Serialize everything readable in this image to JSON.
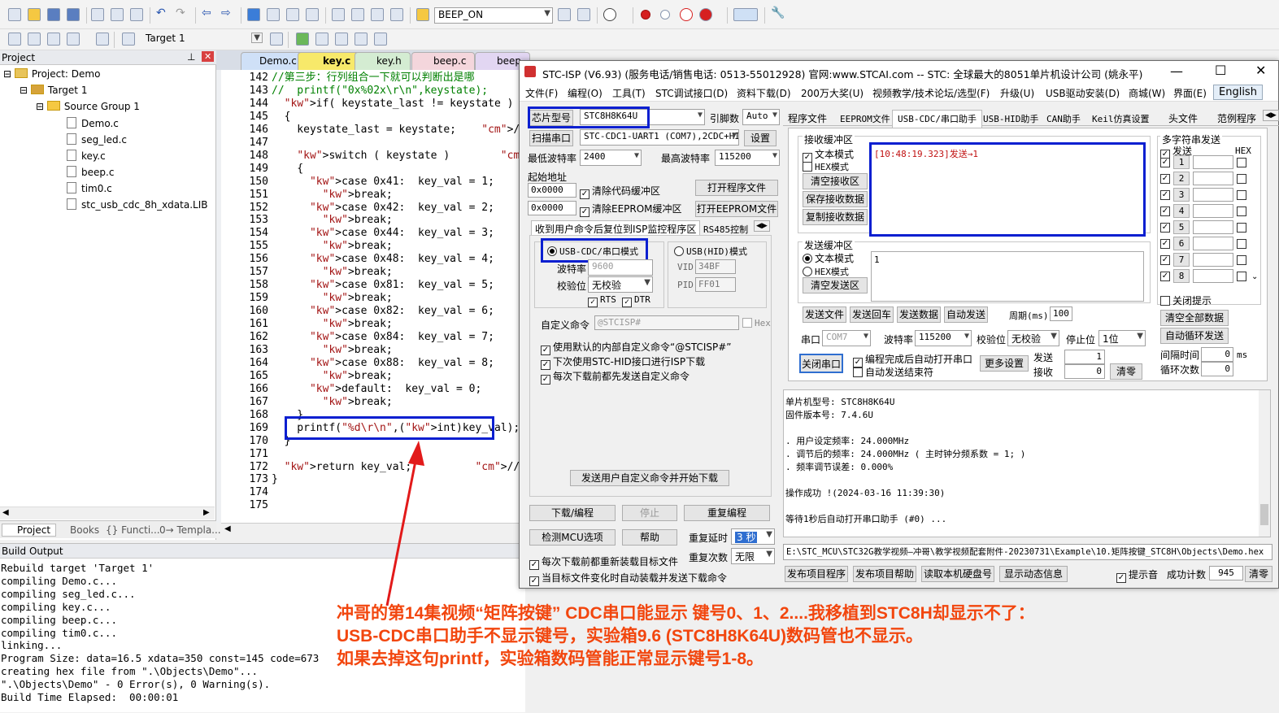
{
  "keil": {
    "toolbar1": {
      "target_combo": "BEEP_ON"
    },
    "toolbar2": {
      "target_combo": "Target 1"
    },
    "project_panel": {
      "title": "Project",
      "items": [
        "Project: Demo",
        "Target 1",
        "Source Group 1",
        "Demo.c",
        "seg_led.c",
        "key.c",
        "beep.c",
        "tim0.c",
        "stc_usb_cdc_8h_xdata.LIB"
      ],
      "bottom_tabs": [
        "Project",
        "Books",
        "{} Functi...",
        "0→ Templa..."
      ]
    },
    "editor_tabs": [
      "Demo.c",
      "key.c",
      "key.h",
      "beep.c",
      "beep"
    ],
    "code": [
      {
        "n": "142",
        "t": "//第三步：行列组合一下就可以判断出是哪",
        "c": "cm"
      },
      {
        "n": "143",
        "t": "//  printf(\"0x%02x\\r\\n\",keystate);",
        "c": "cm"
      },
      {
        "n": "144",
        "t": "  if( keystate_last != keystate )    //",
        "c": ""
      },
      {
        "n": "145",
        "t": "  {",
        "c": ""
      },
      {
        "n": "146",
        "t": "    keystate_last = keystate;    //把本",
        "c": ""
      },
      {
        "n": "147",
        "t": "",
        "c": ""
      },
      {
        "n": "148",
        "t": "    switch ( keystate )        //根据这",
        "c": ""
      },
      {
        "n": "149",
        "t": "    {",
        "c": ""
      },
      {
        "n": "150",
        "t": "      case 0x41:  key_val = 1;",
        "c": ""
      },
      {
        "n": "151",
        "t": "        break;",
        "c": ""
      },
      {
        "n": "152",
        "t": "      case 0x42:  key_val = 2;",
        "c": ""
      },
      {
        "n": "153",
        "t": "        break;",
        "c": ""
      },
      {
        "n": "154",
        "t": "      case 0x44:  key_val = 3;",
        "c": ""
      },
      {
        "n": "155",
        "t": "        break;",
        "c": ""
      },
      {
        "n": "156",
        "t": "      case 0x48:  key_val = 4;",
        "c": ""
      },
      {
        "n": "157",
        "t": "        break;",
        "c": ""
      },
      {
        "n": "158",
        "t": "      case 0x81:  key_val = 5;",
        "c": ""
      },
      {
        "n": "159",
        "t": "        break;",
        "c": ""
      },
      {
        "n": "160",
        "t": "      case 0x82:  key_val = 6;",
        "c": ""
      },
      {
        "n": "161",
        "t": "        break;",
        "c": ""
      },
      {
        "n": "162",
        "t": "      case 0x84:  key_val = 7;",
        "c": ""
      },
      {
        "n": "163",
        "t": "        break;",
        "c": ""
      },
      {
        "n": "164",
        "t": "      case 0x88:  key_val = 8;",
        "c": ""
      },
      {
        "n": "165",
        "t": "        break;",
        "c": ""
      },
      {
        "n": "166",
        "t": "      default:  key_val = 0;",
        "c": ""
      },
      {
        "n": "167",
        "t": "        break;",
        "c": ""
      },
      {
        "n": "168",
        "t": "    }",
        "c": ""
      },
      {
        "n": "169",
        "t": "    printf(\"%d\\r\\n\",(int)key_val);",
        "c": ""
      },
      {
        "n": "170",
        "t": "  }",
        "c": ""
      },
      {
        "n": "171",
        "t": "",
        "c": ""
      },
      {
        "n": "172",
        "t": "  return key_val;          //返回最终",
        "c": ""
      },
      {
        "n": "173",
        "t": "}",
        "c": ""
      },
      {
        "n": "174",
        "t": "",
        "c": ""
      },
      {
        "n": "175",
        "t": "",
        "c": ""
      }
    ],
    "build_output": {
      "title": "Build Output",
      "lines": [
        "Rebuild target 'Target 1'",
        "compiling Demo.c...",
        "compiling seg_led.c...",
        "compiling key.c...",
        "compiling beep.c...",
        "compiling tim0.c...",
        "linking...",
        "Program Size: data=16.5 xdata=350 const=145 code=673",
        "creating hex file from \".\\Objects\\Demo\"...",
        "\".\\Objects\\Demo\" - 0 Error(s), 0 Warning(s).",
        "Build Time Elapsed:  00:00:01"
      ]
    }
  },
  "isp": {
    "title": "STC-ISP (V6.93) (服务电话/销售电话: 0513-55012928) 官网:www.STCAI.com  -- STC: 全球最大的8051单片机设计公司 (姚永平)",
    "menu": [
      "文件(F)",
      "编程(O)",
      "工具(T)",
      "STC调试接口(D)",
      "资料下载(D)",
      "200万大奖(U)",
      "视频教学/技术论坛/选型(F)",
      "升级(U)",
      "USB驱动安装(D)",
      "商城(W)",
      "界面(E)",
      "English"
    ],
    "left": {
      "chip_btn": "芯片型号",
      "chip_value": "STC8H8K64U",
      "pins_label": "引脚数",
      "pins_value": "Auto",
      "scan_btn": "扫描串口",
      "port_value": "STC-CDC1-UART1 (COM7),2CDC+HI",
      "settings_btn": "设置",
      "min_baud_label": "最低波特率",
      "min_baud": "2400",
      "max_baud_label": "最高波特率",
      "max_baud": "115200",
      "start_addr_label": "起始地址",
      "addr1": "0x0000",
      "clear_code": "清除代码缓冲区",
      "open_prog": "打开程序文件",
      "addr2": "0x0000",
      "clear_eeprom": "清除EEPROM缓冲区",
      "open_eeprom": "打开EEPROM文件",
      "tab1": "收到用户命令后复位到ISP监控程序区",
      "tab2": "RS485控制",
      "usb_cdc_mode": "USB-CDC/串口模式",
      "usb_hid_mode": "USB(HID)模式",
      "baud_label": "波特率",
      "baud_value": "9600",
      "parity_label": "校验位",
      "parity_value": "无校验",
      "rts": "RTS",
      "dtr": "DTR",
      "vid_label": "VID",
      "vid": "34BF",
      "pid_label": "PID",
      "pid": "FF01",
      "custom_cmd_label": "自定义命令",
      "custom_cmd": "@STCISP#",
      "hex": "Hex",
      "opt1": "使用默认的内部自定义命令“@STCISP#”",
      "opt2": "下次使用STC-HID接口进行ISP下载",
      "opt3": "每次下载前都先发送自定义命令",
      "send_custom": "发送用户自定义命令并开始下载",
      "download_btn": "下载/编程",
      "stop_btn": "停止",
      "reprogram_btn": "重复编程",
      "detect_btn": "检测MCU选项",
      "help_btn": "帮助",
      "repeat_delay_label": "重复延时",
      "repeat_delay": "3 秒",
      "repeat_count_label": "重复次数",
      "repeat_count": "无限",
      "reload_opt": "每次下载前都重新装载目标文件",
      "autoload_opt": "当目标文件变化时自动装载并发送下载命令"
    },
    "right": {
      "tabs": [
        "程序文件",
        "EEPROM文件",
        "USB-CDC/串口助手",
        "USB-HID助手",
        "CAN助手",
        "Keil仿真设置",
        "头文件",
        "范例程序"
      ],
      "recv_label": "接收缓冲区",
      "text_mode": "文本模式",
      "hex_mode": "HEX模式",
      "clear_recv": "清空接收区",
      "save_recv": "保存接收数据",
      "copy_recv": "复制接收数据",
      "recv_text": "[10:48:19.323]发送→1",
      "send_label": "发送缓冲区",
      "send_text_mode": "文本模式",
      "send_hex_mode": "HEX模式",
      "clear_send": "清空发送区",
      "send_text": "1",
      "send_file": "发送文件",
      "send_enter": "发送回车",
      "send_data": "发送数据",
      "auto_send": "自动发送",
      "period_label": "周期(ms)",
      "period": "100",
      "port_label": "串口",
      "port": "COM7",
      "baud_label": "波特率",
      "baud": "115200",
      "parity_label": "校验位",
      "parity": "无校验",
      "stop_label": "停止位",
      "stop": "1位",
      "close_port": "关闭串口",
      "auto_open": "编程完成后自动打开串口",
      "auto_end": "自动发送结束符",
      "more_settings": "更多设置",
      "sent_label": "发送",
      "sent": "1",
      "recv_count_label": "接收",
      "recv_count": "0",
      "clear_count": "清零",
      "multi_title": "多字符串发送",
      "multi_send": "发送",
      "multi_hex": "HEX",
      "multi_rows": [
        "1",
        "2",
        "3",
        "4",
        "5",
        "6",
        "7",
        "8"
      ],
      "close_tip": "关闭提示",
      "clear_all": "清空全部数据",
      "auto_loop": "自动循环发送",
      "interval_label": "间隔时间",
      "interval": "0",
      "interval_unit": "ms",
      "loop_label": "循环次数",
      "loop": "0"
    },
    "log": [
      "单片机型号: STC8H8K64U",
      "固件版本号: 7.4.6U",
      "",
      ". 用户设定频率: 24.000MHz",
      ". 调节后的频率: 24.000MHz ( 主时钟分频系数 = 1; )",
      ". 频率调节误差: 0.000%",
      "",
      "操作成功 !(2024-03-16 11:39:30)",
      "",
      "等待1秒后自动打开串口助手 (#0) ..."
    ],
    "path": "E:\\STC_MCU\\STC32G教学视频—冲哥\\教学视频配套附件-20230731\\Example\\10.矩阵按键_STC8H\\Objects\\Demo.hex",
    "bottom": {
      "publish_prog": "发布项目程序",
      "publish_help": "发布项目帮助",
      "read_disk": "读取本机硬盘号",
      "show_dynamic": "显示动态信息",
      "beep": "提示音",
      "success_label": "成功计数",
      "success": "945",
      "clear": "清零"
    }
  },
  "annotation": [
    "冲哥的第14集视频“矩阵按键” CDC串口能显示 键号0、1、2....我移植到STC8H却显示不了：",
    "USB-CDC串口助手不显示键号，实验箱9.6 (STC8H8K64U)数码管也不显示。",
    "如果去掉这句printf，实验箱数码管能正常显示键号1-8。"
  ],
  "colors": {
    "highlight_box": "#0a1fd0",
    "annotation": "#f2460e",
    "comment": "#008000",
    "keyword": "#0000ff"
  }
}
